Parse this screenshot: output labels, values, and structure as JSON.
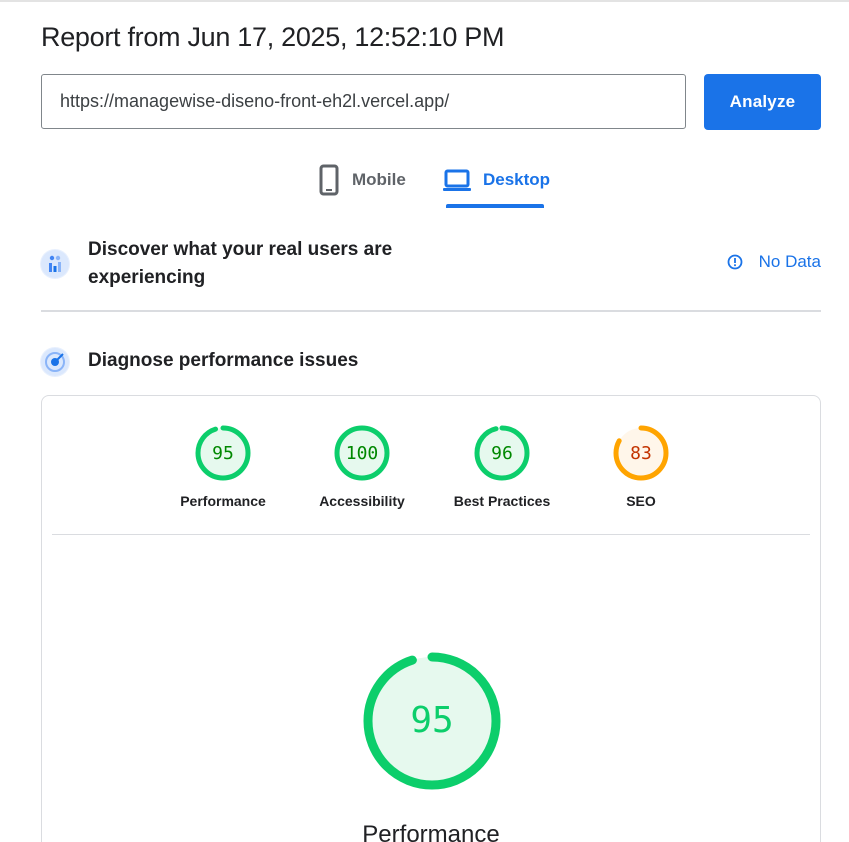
{
  "report": {
    "title": "Report from Jun 17, 2025, 12:52:10 PM"
  },
  "search": {
    "url": "https://managewise-diseno-front-eh2l.vercel.app/",
    "analyze_label": "Analyze"
  },
  "tabs": [
    {
      "label": "Mobile",
      "icon": "phone-icon",
      "selected": false
    },
    {
      "label": "Desktop",
      "icon": "laptop-icon",
      "selected": true
    }
  ],
  "crux": {
    "heading": "Discover what your real users are experiencing",
    "status": "No Data",
    "icon": "users-chart-icon"
  },
  "diagnose": {
    "heading": "Diagnose performance issues",
    "icon": "lighthouse-icon"
  },
  "scores": [
    {
      "label": "Performance",
      "value": 95,
      "status": "good"
    },
    {
      "label": "Accessibility",
      "value": 100,
      "status": "good"
    },
    {
      "label": "Best Practices",
      "value": 96,
      "status": "good"
    },
    {
      "label": "SEO",
      "value": 83,
      "status": "average"
    }
  ],
  "main_score": {
    "label": "Performance",
    "value": 95
  },
  "colors": {
    "accent": "#1a73e8",
    "good": "#0cce6b",
    "good_text": "#008800",
    "good_bg": "#e6f9ee",
    "average": "#ffa400",
    "average_text": "#c33300",
    "average_bg": "#fff6ea",
    "track": "#ffffff"
  }
}
